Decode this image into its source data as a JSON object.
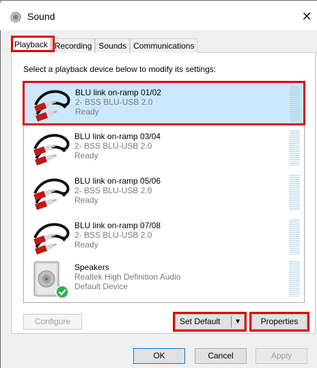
{
  "window": {
    "title": "Sound",
    "close_glyph": "✕"
  },
  "tabs": [
    {
      "label": "Playback",
      "active": true
    },
    {
      "label": "Recording",
      "active": false
    },
    {
      "label": "Sounds",
      "active": false
    },
    {
      "label": "Communications",
      "active": false
    }
  ],
  "instruction": "Select a playback device below to modify its settings:",
  "devices": [
    {
      "name": "BLU link on-ramp 01/02",
      "subtitle": "2- BSS BLU-USB 2.0",
      "status": "Ready",
      "icon": "rca-cable-icon",
      "selected": true
    },
    {
      "name": "BLU link on-ramp 03/04",
      "subtitle": "2- BSS BLU-USB 2.0",
      "status": "Ready",
      "icon": "rca-cable-icon",
      "selected": false
    },
    {
      "name": "BLU link on-ramp 05/06",
      "subtitle": "2- BSS BLU-USB 2.0",
      "status": "Ready",
      "icon": "rca-cable-icon",
      "selected": false
    },
    {
      "name": "BLU link on-ramp 07/08",
      "subtitle": "2- BSS BLU-USB 2.0",
      "status": "Ready",
      "icon": "rca-cable-icon",
      "selected": false
    },
    {
      "name": "Speakers",
      "subtitle": "Realtek High Definition Audio",
      "status": "Default Device",
      "icon": "speaker-icon",
      "selected": false
    }
  ],
  "buttons": {
    "configure": "Configure",
    "set_default": "Set Default",
    "properties": "Properties",
    "ok": "OK",
    "cancel": "Cancel",
    "apply": "Apply"
  },
  "colors": {
    "highlight": "#e00000",
    "selection": "#cce8ff",
    "default_check": "#2bb24c"
  }
}
